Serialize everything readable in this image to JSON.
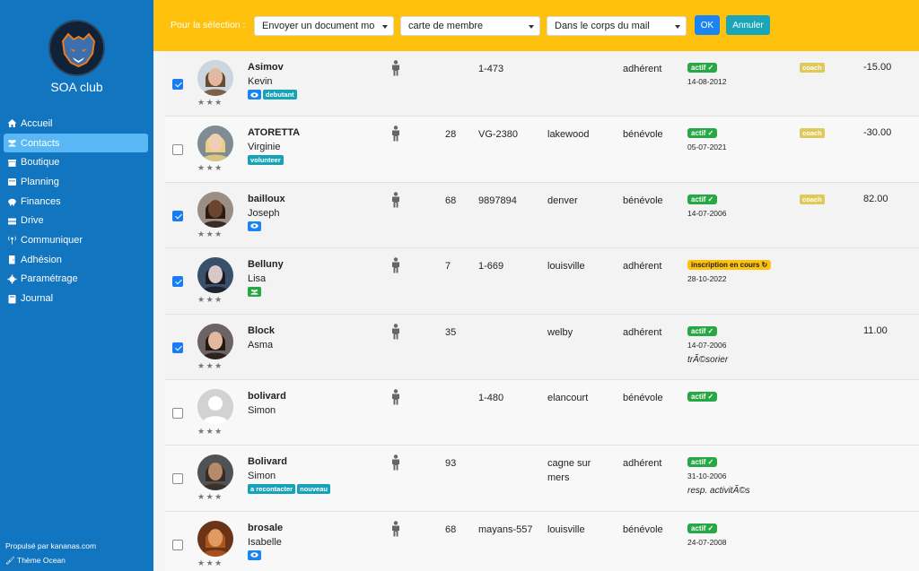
{
  "sidebar": {
    "club_name": "SOA club",
    "items": [
      {
        "label": "Accueil",
        "icon": "home-icon",
        "active": false
      },
      {
        "label": "Contacts",
        "icon": "users-icon",
        "active": true
      },
      {
        "label": "Boutique",
        "icon": "shop-icon",
        "active": false
      },
      {
        "label": "Planning",
        "icon": "calendar-icon",
        "active": false
      },
      {
        "label": "Finances",
        "icon": "piggy-bank-icon",
        "active": false
      },
      {
        "label": "Drive",
        "icon": "drive-icon",
        "active": false
      },
      {
        "label": "Communiquer",
        "icon": "broadcast-icon",
        "active": false
      },
      {
        "label": "Adhésion",
        "icon": "door-icon",
        "active": false
      },
      {
        "label": "Paramétrage",
        "icon": "gear-icon",
        "active": false
      },
      {
        "label": "Journal",
        "icon": "book-icon",
        "active": false
      }
    ],
    "footer_powered": "Propulsé par kananas.com",
    "footer_theme": "Thème Ocean"
  },
  "toolbar": {
    "label": "Pour la sélection :",
    "select1": "Envoyer un document mo",
    "select2": "carte de membre",
    "select3": "Dans le corps du mail",
    "ok_label": "OK",
    "cancel_label": "Annuler"
  },
  "colors": {
    "sidebar": "#1175c0",
    "sidebar_active": "#59b7f5",
    "topbar": "#fec10e",
    "badge_active": "#28a745",
    "coach_tag": "#dfc95a"
  },
  "contacts": [
    {
      "checked": true,
      "last": "Asimov",
      "first": "Kevin",
      "tags": [
        "eye",
        "debutant"
      ],
      "age": "",
      "code": "1-473",
      "city": "",
      "type": "adhérent",
      "status": "actif",
      "status_kind": "active",
      "date": "14-08-2012",
      "role": "",
      "coach": "coach",
      "amount": "-15.00"
    },
    {
      "checked": false,
      "last": "ATORETTA",
      "first": "Virginie",
      "tags": [
        "volunteer"
      ],
      "age": "28",
      "code": "VG-2380",
      "city": "lakewood",
      "type": "bénévole",
      "status": "actif",
      "status_kind": "active",
      "date": "05-07-2021",
      "role": "",
      "coach": "coach",
      "amount": "-30.00"
    },
    {
      "checked": true,
      "last": "bailloux",
      "first": "Joseph",
      "tags": [
        "eye"
      ],
      "age": "68",
      "code": "9897894",
      "city": "denver",
      "type": "bénévole",
      "status": "actif",
      "status_kind": "active",
      "date": "14-07-2006",
      "role": "",
      "coach": "coach",
      "amount": "82.00"
    },
    {
      "checked": true,
      "last": "Belluny",
      "first": "Lisa",
      "tags": [
        "group"
      ],
      "age": "7",
      "code": "1-669",
      "city": "louisville",
      "type": "adhérent",
      "status": "inscription en cours",
      "status_kind": "pending",
      "date": "28-10-2022",
      "role": "",
      "coach": "",
      "amount": ""
    },
    {
      "checked": true,
      "last": "Block",
      "first": "Asma",
      "tags": [],
      "age": "35",
      "code": "",
      "city": "welby",
      "type": "adhérent",
      "status": "actif",
      "status_kind": "active",
      "date": "14-07-2006",
      "role": "trÃ©sorier",
      "coach": "",
      "amount": "11.00"
    },
    {
      "checked": false,
      "last": "bolivard",
      "first": "Simon",
      "tags": [],
      "age": "",
      "code": "1-480",
      "city": "elancourt",
      "type": "bénévole",
      "status": "actif",
      "status_kind": "active",
      "date": "",
      "role": "",
      "coach": "",
      "amount": ""
    },
    {
      "checked": false,
      "last": "Bolivard",
      "first": "Simon",
      "tags": [
        "a recontacter",
        "nouveau"
      ],
      "age": "93",
      "code": "",
      "city": "cagne sur mers",
      "type": "adhérent",
      "status": "actif",
      "status_kind": "active",
      "date": "31-10-2006",
      "role": "resp. activitÃ©s",
      "coach": "",
      "amount": ""
    },
    {
      "checked": false,
      "last": "brosale",
      "first": "Isabelle",
      "tags": [
        "eye"
      ],
      "age": "68",
      "code": "mayans-557",
      "city": "louisville",
      "type": "bénévole",
      "status": "actif",
      "status_kind": "active",
      "date": "24-07-2008",
      "role": "",
      "coach": "",
      "amount": ""
    }
  ]
}
